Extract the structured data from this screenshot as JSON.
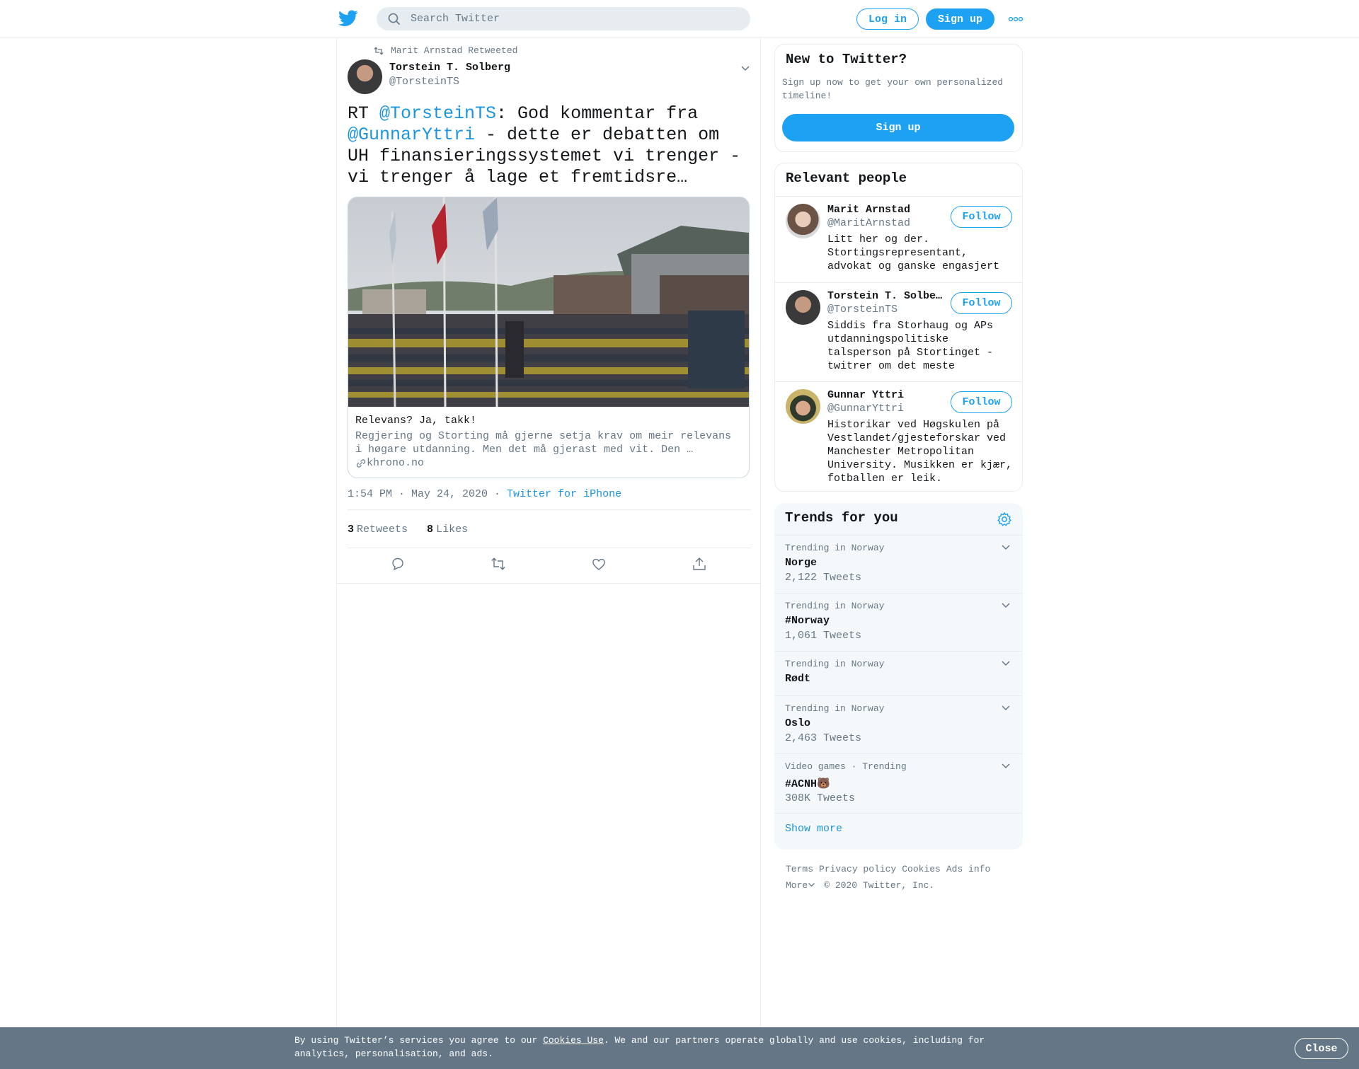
{
  "header": {
    "search_placeholder": "Search Twitter",
    "login_label": "Log in",
    "signup_label": "Sign up"
  },
  "tweet": {
    "retweeted_by": "Marit Arnstad Retweeted",
    "author_name": "Torstein T. Solberg",
    "author_handle": "@TorsteinTS",
    "text_prefix": "RT ",
    "mention_1": "@TorsteinTS",
    "text_mid": ": God kommentar fra ",
    "mention_2": "@GunnarYttri",
    "text_suffix": " - dette er debatten om UH finansieringssystemet vi trenger - vi trenger å lage et fremtidsre…",
    "card": {
      "title": "Relevans? Ja, takk!",
      "description": "Regjering og Storting må gjerne setja krav om meir relevans i høgare utdanning. Men det må gjerast med vit. Den …",
      "domain": "khrono.no"
    },
    "timestamp": "1:54 PM · May 24, 2020 · ",
    "source": "Twitter for iPhone",
    "retweets_count": "3",
    "retweets_label": "Retweets",
    "likes_count": "8",
    "likes_label": "Likes"
  },
  "sidebar": {
    "new_title": "New to Twitter?",
    "new_subtitle": "Sign up now to get your own personalized timeline!",
    "new_signup": "Sign up",
    "people_title": "Relevant people",
    "people": [
      {
        "name": "Marit Arnstad",
        "handle": "@MaritArnstad",
        "bio": "Litt her og der. Stortingsrepresentant, advokat og ganske engasjert",
        "follow": "Follow"
      },
      {
        "name": "Torstein T. Solberg",
        "handle": "@TorsteinTS",
        "bio": "Siddis fra Storhaug og APs utdanningspolitiske talsperson på Stortinget - twitrer om det meste",
        "follow": "Follow"
      },
      {
        "name": "Gunnar Yttri",
        "handle": "@GunnarYttri",
        "bio": "Historikar ved Høgskulen på Vestlandet/gjesteforskar ved Manchester Metropolitan University. Musikken er kjær, fotballen er leik.",
        "follow": "Follow"
      }
    ],
    "trends_title": "Trends for you",
    "trends": [
      {
        "context": "Trending in Norway",
        "name": "Norge",
        "count": "2,122 Tweets"
      },
      {
        "context": "Trending in Norway",
        "name": "#Norway",
        "count": "1,061 Tweets"
      },
      {
        "context": "Trending in Norway",
        "name": "Rødt",
        "count": ""
      },
      {
        "context": "Trending in Norway",
        "name": "Oslo",
        "count": "2,463 Tweets"
      },
      {
        "context": "Video games · Trending",
        "name": "#ACNH🐻",
        "count": "308K Tweets"
      }
    ],
    "show_more": "Show more",
    "footer": {
      "terms": "Terms",
      "privacy": "Privacy policy",
      "cookies": "Cookies",
      "ads": "Ads info",
      "more": "More",
      "copyright": "© 2020 Twitter, Inc."
    }
  },
  "cookie_bar": {
    "text_before": "By using Twitter’s services you agree to our ",
    "link": "Cookies Use",
    "text_after": ". We and our partners operate globally and use cookies, including for analytics, personalisation, and ads.",
    "close": "Close"
  },
  "colors": {
    "brand": "#1da1f2",
    "link": "#1b95e0",
    "muted": "#657786",
    "cookie_bg": "#657786"
  }
}
